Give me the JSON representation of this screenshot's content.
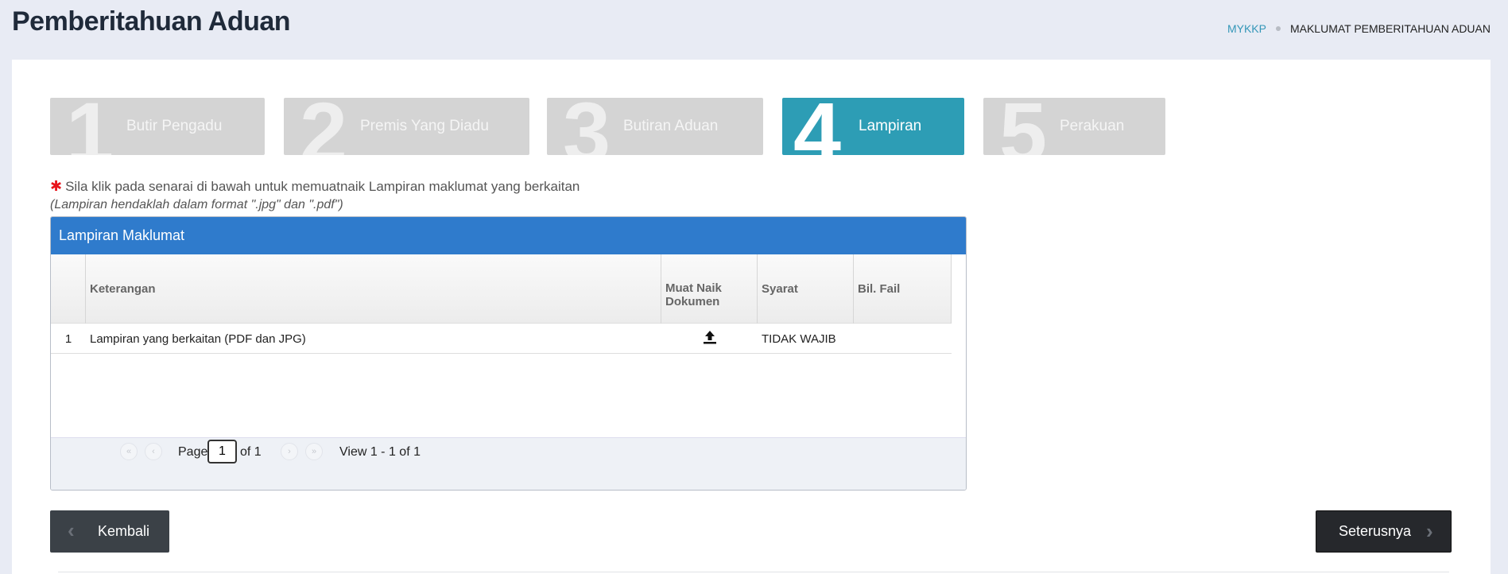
{
  "header": {
    "title": "Pemberitahuan Aduan",
    "breadcrumb": {
      "home": "MYKKP",
      "current": "MAKLUMAT PEMBERITAHUAN ADUAN"
    }
  },
  "steps": [
    {
      "num": "1",
      "label": "Butir Pengadu",
      "active": false
    },
    {
      "num": "2",
      "label": "Premis Yang Diadu",
      "active": false
    },
    {
      "num": "3",
      "label": "Butiran Aduan",
      "active": false
    },
    {
      "num": "4",
      "label": "Lampiran",
      "active": true
    },
    {
      "num": "5",
      "label": "Perakuan",
      "active": false
    }
  ],
  "instruction": {
    "star": "✱",
    "text": "Sila klik pada senarai di bawah untuk memuatnaik Lampiran maklumat yang berkaitan",
    "note": "(Lampiran hendaklah dalam format \".jpg\" dan \".pdf\")"
  },
  "grid": {
    "title": "Lampiran Maklumat",
    "columns": [
      "",
      "Keterangan",
      "Muat Naik Dokumen",
      "Syarat",
      "Bil. Fail"
    ],
    "rows": [
      {
        "no": "1",
        "keterangan": "Lampiran yang berkaitan (PDF dan JPG)",
        "upload_icon": "upload-icon",
        "syarat": "TIDAK WAJIB",
        "bil_fail": ""
      }
    ],
    "pager": {
      "page_label": "Page",
      "page_value": "1",
      "of_label": "of 1",
      "view": "View 1 - 1 of 1"
    }
  },
  "buttons": {
    "back": "Kembali",
    "next": "Seterusnya"
  },
  "colors": {
    "active_step": "#2d9db5",
    "grid_header": "#2f7bcc",
    "required": "#e8141b"
  }
}
